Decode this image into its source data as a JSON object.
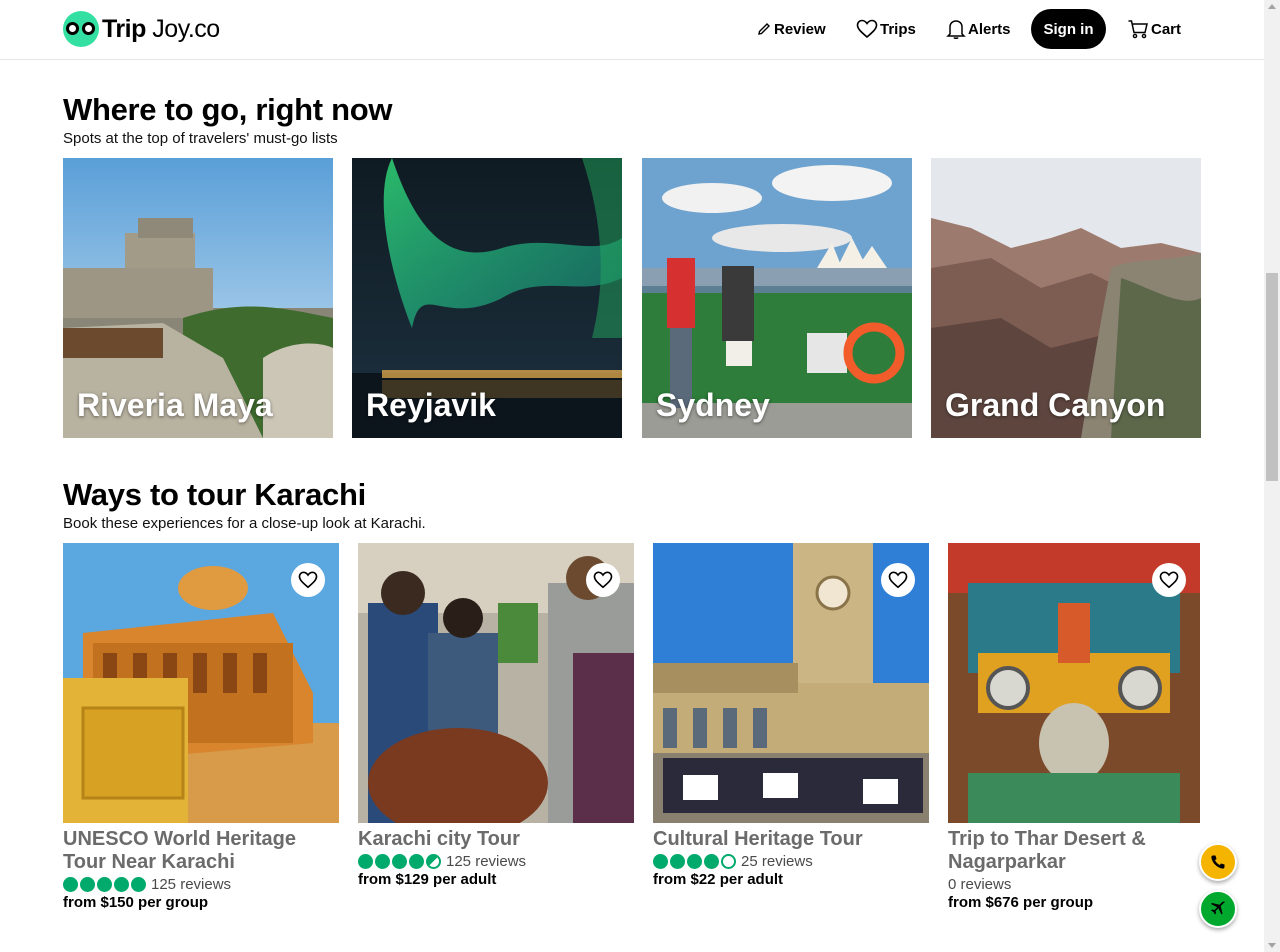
{
  "brand": {
    "name_bold": "Trip",
    "name_light": "Joy.co"
  },
  "nav": {
    "review": "Review",
    "trips": "Trips",
    "alerts": "Alerts",
    "signin": "Sign in",
    "cart": "Cart"
  },
  "where": {
    "title": "Where to go, right now",
    "subtitle": "Spots at the top of travelers' must-go lists",
    "items": [
      {
        "label": "Riveria Maya"
      },
      {
        "label": "Reyjavik"
      },
      {
        "label": "Sydney"
      },
      {
        "label": "Grand Canyon"
      }
    ]
  },
  "tours": {
    "title": "Ways to tour Karachi",
    "subtitle": "Book these experiences for a close-up look at Karachi.",
    "items": [
      {
        "title": "UNESCO World Heritage Tour Near Karachi",
        "rating": 5,
        "reviews": "125 reviews",
        "price": "from $150 per group"
      },
      {
        "title": "Karachi city Tour",
        "rating": 4.5,
        "reviews": "125 reviews",
        "price": "from $129 per adult"
      },
      {
        "title": "Cultural Heritage Tour",
        "rating": 4,
        "reviews": "25 reviews",
        "price": "from $22 per adult"
      },
      {
        "title": "Trip to Thar Desert & Nagarparkar",
        "rating": 0,
        "reviews": "0 reviews",
        "price": "from $676 per group"
      }
    ]
  },
  "colors": {
    "brand_green": "#34e0a1",
    "bubble_green": "#00aa6c",
    "call_button": "#f5b400",
    "flight_button": "#00a82d"
  },
  "fab": {
    "call_icon": "phone-icon",
    "flight_icon": "airplane-icon"
  }
}
